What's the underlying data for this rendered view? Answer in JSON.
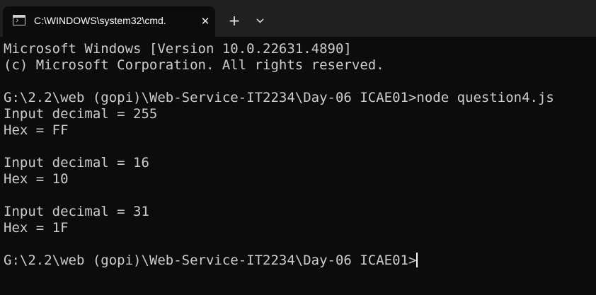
{
  "window": {
    "tab_title": "C:\\WINDOWS\\system32\\cmd.",
    "close_glyph": "✕",
    "new_tab_glyph": "+",
    "tab_icon": "command-prompt-icon",
    "dropdown_icon": "chevron-down-icon"
  },
  "terminal": {
    "lines": [
      "Microsoft Windows [Version 10.0.22631.4890]",
      "(c) Microsoft Corporation. All rights reserved.",
      "",
      "G:\\2.2\\web (gopi)\\Web-Service-IT2234\\Day-06 ICAE01>node question4.js",
      "Input decimal = 255",
      "Hex = FF",
      "",
      "Input decimal = 16",
      "Hex = 10",
      "",
      "Input decimal = 31",
      "Hex = 1F",
      ""
    ],
    "prompt": "G:\\2.2\\web (gopi)\\Web-Service-IT2234\\Day-06 ICAE01>"
  },
  "colors": {
    "background": "#0c0c0c",
    "tabstrip": "#202020",
    "text": "#cccccc"
  }
}
